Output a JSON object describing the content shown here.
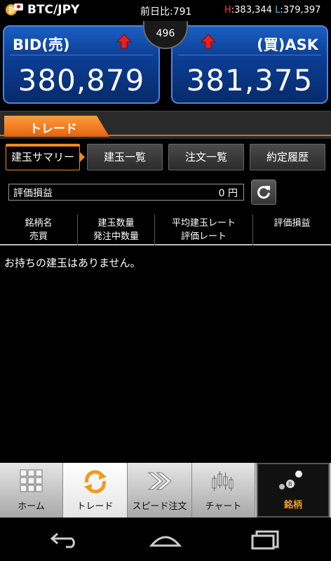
{
  "header": {
    "pair": "BTC/JPY",
    "btc_symbol": "₿",
    "prev_label": "前日比:",
    "prev_value": "791",
    "high_label": "H",
    "high_value": ":383,344",
    "low_label": "L",
    "low_value": ":379,397"
  },
  "bid": {
    "label": "BID(売)",
    "price": "380,879"
  },
  "ask": {
    "label": "(買)ASK",
    "price": "381,375"
  },
  "spread": "496",
  "trade_tab": "トレード",
  "subtabs": [
    "建玉サマリー",
    "建玉一覧",
    "注文一覧",
    "約定履歴"
  ],
  "summary": {
    "label": "評価損益",
    "value": "0 円"
  },
  "columns": [
    {
      "line1": "銘柄名",
      "line2": "売買"
    },
    {
      "line1": "建玉数量",
      "line2": "発注中数量"
    },
    {
      "line1": "平均建玉レート",
      "line2": "評価レート"
    },
    {
      "line1": "評価損益",
      "line2": ""
    }
  ],
  "empty_message": "お持ちの建玉はありません。",
  "nav": [
    "ホーム",
    "トレード",
    "スピード注文",
    "チャート",
    "銘柄"
  ],
  "colors": {
    "accent": "#f08a1e",
    "bid_panel": "#0c3e95",
    "high": "#ff3b3b",
    "low": "#36c3ff"
  }
}
